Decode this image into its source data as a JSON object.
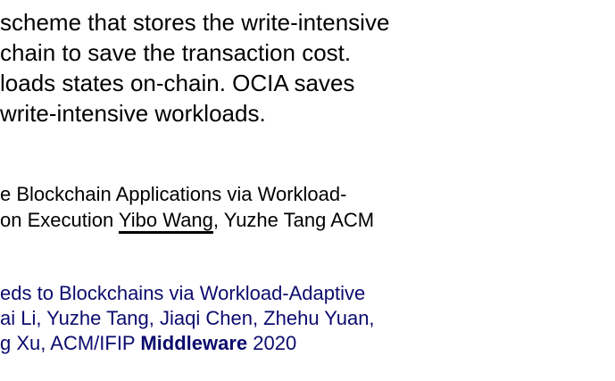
{
  "paragraph": {
    "lines": [
      "scheme that stores the write-intensive",
      "chain to save the transaction cost.",
      "loads states on-chain. OCIA saves",
      "write-intensive workloads."
    ]
  },
  "publication_1": {
    "line1": "e Blockchain Applications via Workload-",
    "line2_prefix": "on Execution ",
    "author_link": "Yibo Wang",
    "line2_suffix": ", Yuzhe Tang ACM"
  },
  "publication_2": {
    "line1": "eds to Blockchains via Workload-Adaptive",
    "line2": "ai Li, Yuzhe Tang, Jiaqi Chen, Zhehu Yuan,",
    "line3_prefix": "g Xu, ACM/IFIP ",
    "venue_bold": "Middleware",
    "line3_suffix": " 2020",
    "color": "#0b0b6e"
  }
}
